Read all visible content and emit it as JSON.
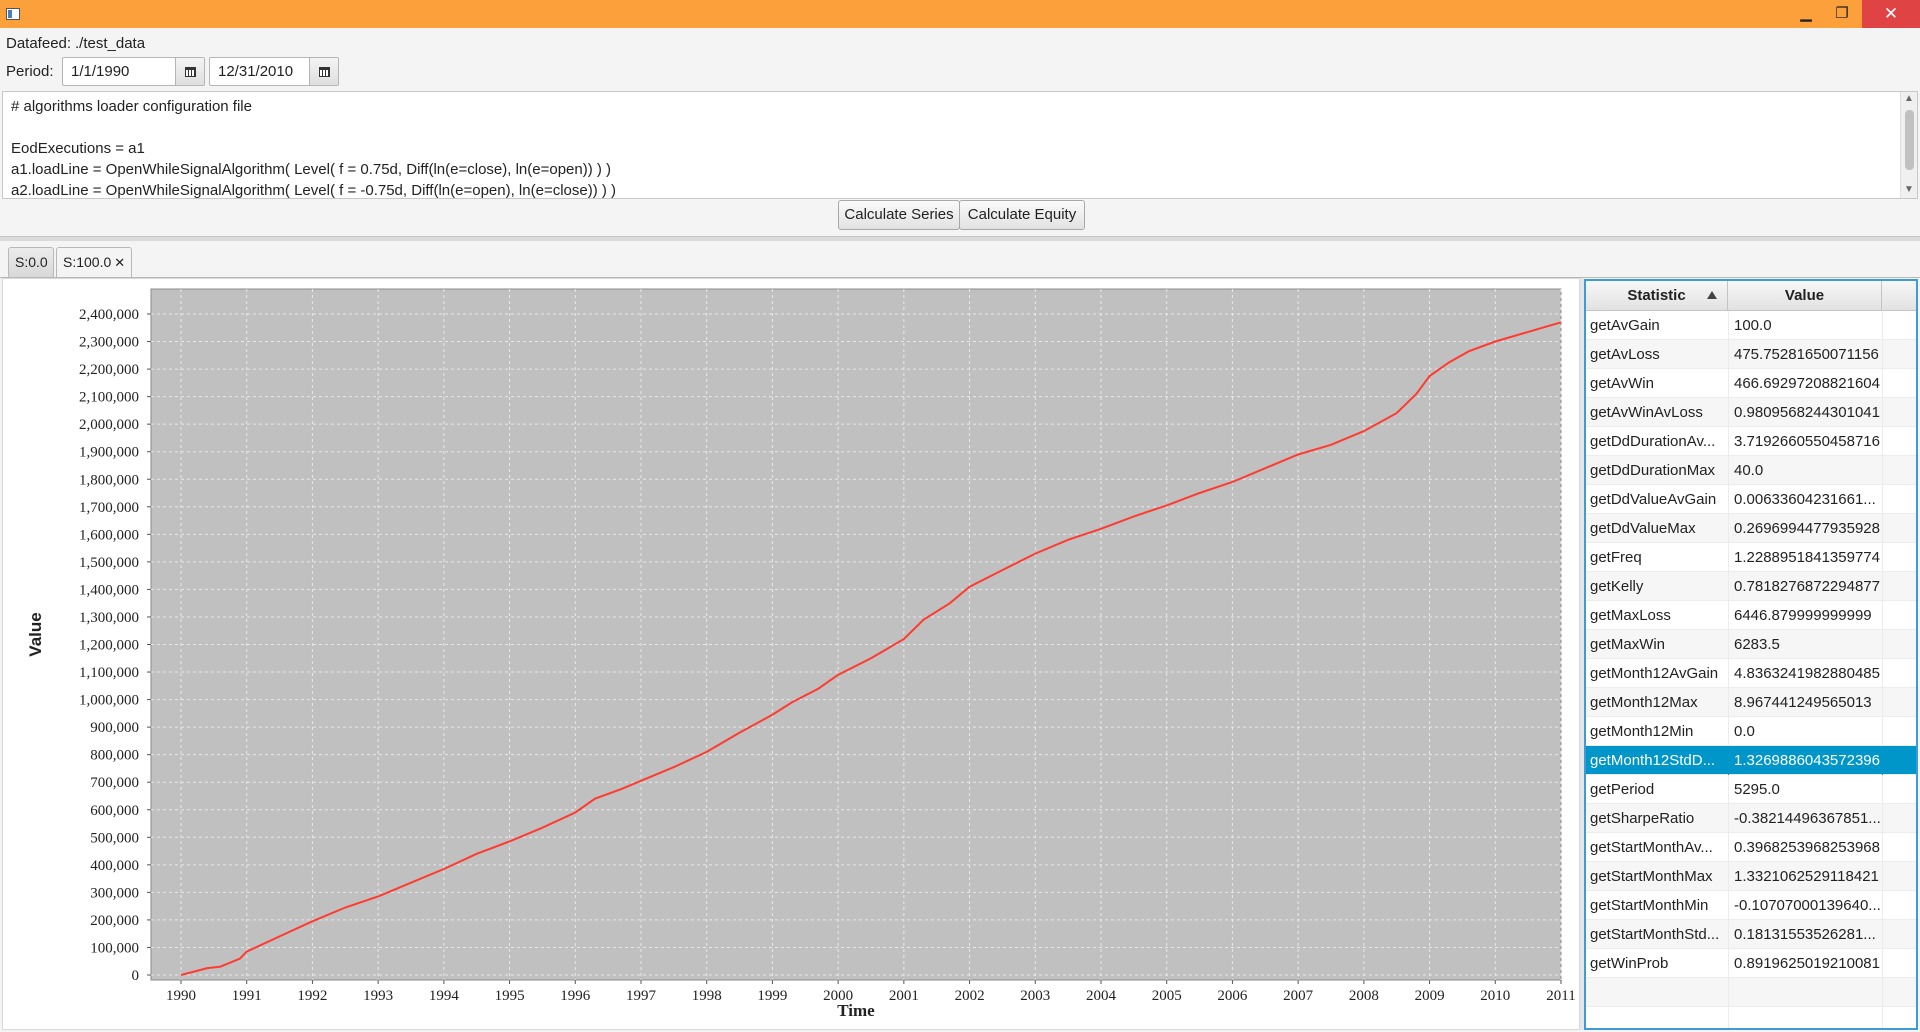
{
  "window": {
    "minimize_glyph": "▁",
    "maximize_glyph": "❐",
    "close_glyph": "✕"
  },
  "toolbar": {
    "datafeed_label": "Datafeed:",
    "datafeed_value": "./test_data",
    "period_label": "Period:",
    "start_date": "1/1/1990",
    "end_date": "12/31/2010"
  },
  "config": {
    "lines": [
      "# algorithms loader configuration file",
      "",
      "EodExecutions = a1",
      "a1.loadLine = OpenWhileSignalAlgorithm( Level( f = 0.75d, Diff(ln(e=close), ln(e=open)) ) )",
      "a2.loadLine = OpenWhileSignalAlgorithm( Level( f = -0.75d, Diff(ln(e=open), ln(e=close)) ) )"
    ]
  },
  "buttons": {
    "calculate_series": "Calculate Series",
    "calculate_equity": "Calculate Equity"
  },
  "tabs": [
    {
      "label": "S:0.0",
      "active": false
    },
    {
      "label": "S:100.0",
      "active": true,
      "close": "✕"
    }
  ],
  "stats_table": {
    "col_statistic": "Statistic",
    "col_value": "Value",
    "selected_index": 15,
    "rows": [
      {
        "name": "getAvGain",
        "value": "100.0"
      },
      {
        "name": "getAvLoss",
        "value": "475.75281650071156"
      },
      {
        "name": "getAvWin",
        "value": "466.69297208821604"
      },
      {
        "name": "getAvWinAvLoss",
        "value": "0.9809568244301041"
      },
      {
        "name": "getDdDurationAv...",
        "value": "3.7192660550458716"
      },
      {
        "name": "getDdDurationMax",
        "value": "40.0"
      },
      {
        "name": "getDdValueAvGain",
        "value": "0.00633604231661..."
      },
      {
        "name": "getDdValueMax",
        "value": "0.2696994477935928"
      },
      {
        "name": "getFreq",
        "value": "1.2288951841359774"
      },
      {
        "name": "getKelly",
        "value": "0.7818276872294877"
      },
      {
        "name": "getMaxLoss",
        "value": "6446.879999999999"
      },
      {
        "name": "getMaxWin",
        "value": "6283.5"
      },
      {
        "name": "getMonth12AvGain",
        "value": "4.8363241982880485"
      },
      {
        "name": "getMonth12Max",
        "value": "8.967441249565013"
      },
      {
        "name": "getMonth12Min",
        "value": "0.0"
      },
      {
        "name": "getMonth12StdD...",
        "value": "1.3269886043572396"
      },
      {
        "name": "getPeriod",
        "value": "5295.0"
      },
      {
        "name": "getSharpeRatio",
        "value": "-0.38214496367851..."
      },
      {
        "name": "getStartMonthAv...",
        "value": "0.3968253968253968"
      },
      {
        "name": "getStartMonthMax",
        "value": "1.3321062529118421"
      },
      {
        "name": "getStartMonthMin",
        "value": "-0.10707000139640..."
      },
      {
        "name": "getStartMonthStd...",
        "value": "0.18131553526281..."
      },
      {
        "name": "getWinProb",
        "value": "0.8919625019210081"
      }
    ],
    "empty_rows": 2
  },
  "chart_data": {
    "type": "line",
    "xlabel": "Time",
    "ylabel": "Value",
    "xlim": [
      1990,
      2011
    ],
    "ylim": [
      0,
      2400000
    ],
    "x_ticks": [
      "1990",
      "1991",
      "1992",
      "1993",
      "1994",
      "1995",
      "1996",
      "1997",
      "1998",
      "1999",
      "2000",
      "2001",
      "2002",
      "2003",
      "2004",
      "2005",
      "2006",
      "2007",
      "2008",
      "2009",
      "2010",
      "2011"
    ],
    "y_ticks": [
      "0",
      "100,000",
      "200,000",
      "300,000",
      "400,000",
      "500,000",
      "600,000",
      "700,000",
      "800,000",
      "900,000",
      "1,000,000",
      "1,100,000",
      "1,200,000",
      "1,300,000",
      "1,400,000",
      "1,500,000",
      "1,600,000",
      "1,700,000",
      "1,800,000",
      "1,900,000",
      "2,000,000",
      "2,100,000",
      "2,200,000",
      "2,300,000",
      "2,400,000"
    ],
    "grid": true,
    "background": "#c0c0c0",
    "line_color": "#ff3b30",
    "series": [
      {
        "x": [
          1990.0,
          1990.4,
          1990.6,
          1990.9,
          1991.0,
          1991.5,
          1992.0,
          1992.5,
          1993.0,
          1993.5,
          1994.0,
          1994.5,
          1995.0,
          1995.5,
          1996.0,
          1996.3,
          1996.7,
          1997.0,
          1997.5,
          1998.0,
          1998.5,
          1999.0,
          1999.3,
          1999.7,
          2000.0,
          2000.5,
          2001.0,
          2001.3,
          2001.7,
          2002.0,
          2002.5,
          2003.0,
          2003.5,
          2004.0,
          2004.5,
          2005.0,
          2005.5,
          2006.0,
          2006.5,
          2007.0,
          2007.5,
          2008.0,
          2008.5,
          2008.8,
          2009.0,
          2009.3,
          2009.6,
          2010.0,
          2010.5,
          2011.0
        ],
        "y": [
          0,
          25000,
          30000,
          60000,
          85000,
          140000,
          195000,
          245000,
          285000,
          335000,
          385000,
          440000,
          485000,
          535000,
          590000,
          640000,
          675000,
          705000,
          755000,
          810000,
          880000,
          945000,
          990000,
          1040000,
          1090000,
          1150000,
          1220000,
          1290000,
          1350000,
          1410000,
          1470000,
          1530000,
          1580000,
          1620000,
          1665000,
          1705000,
          1750000,
          1790000,
          1840000,
          1890000,
          1925000,
          1975000,
          2040000,
          2110000,
          2175000,
          2225000,
          2265000,
          2300000,
          2335000,
          2370000
        ]
      }
    ]
  }
}
